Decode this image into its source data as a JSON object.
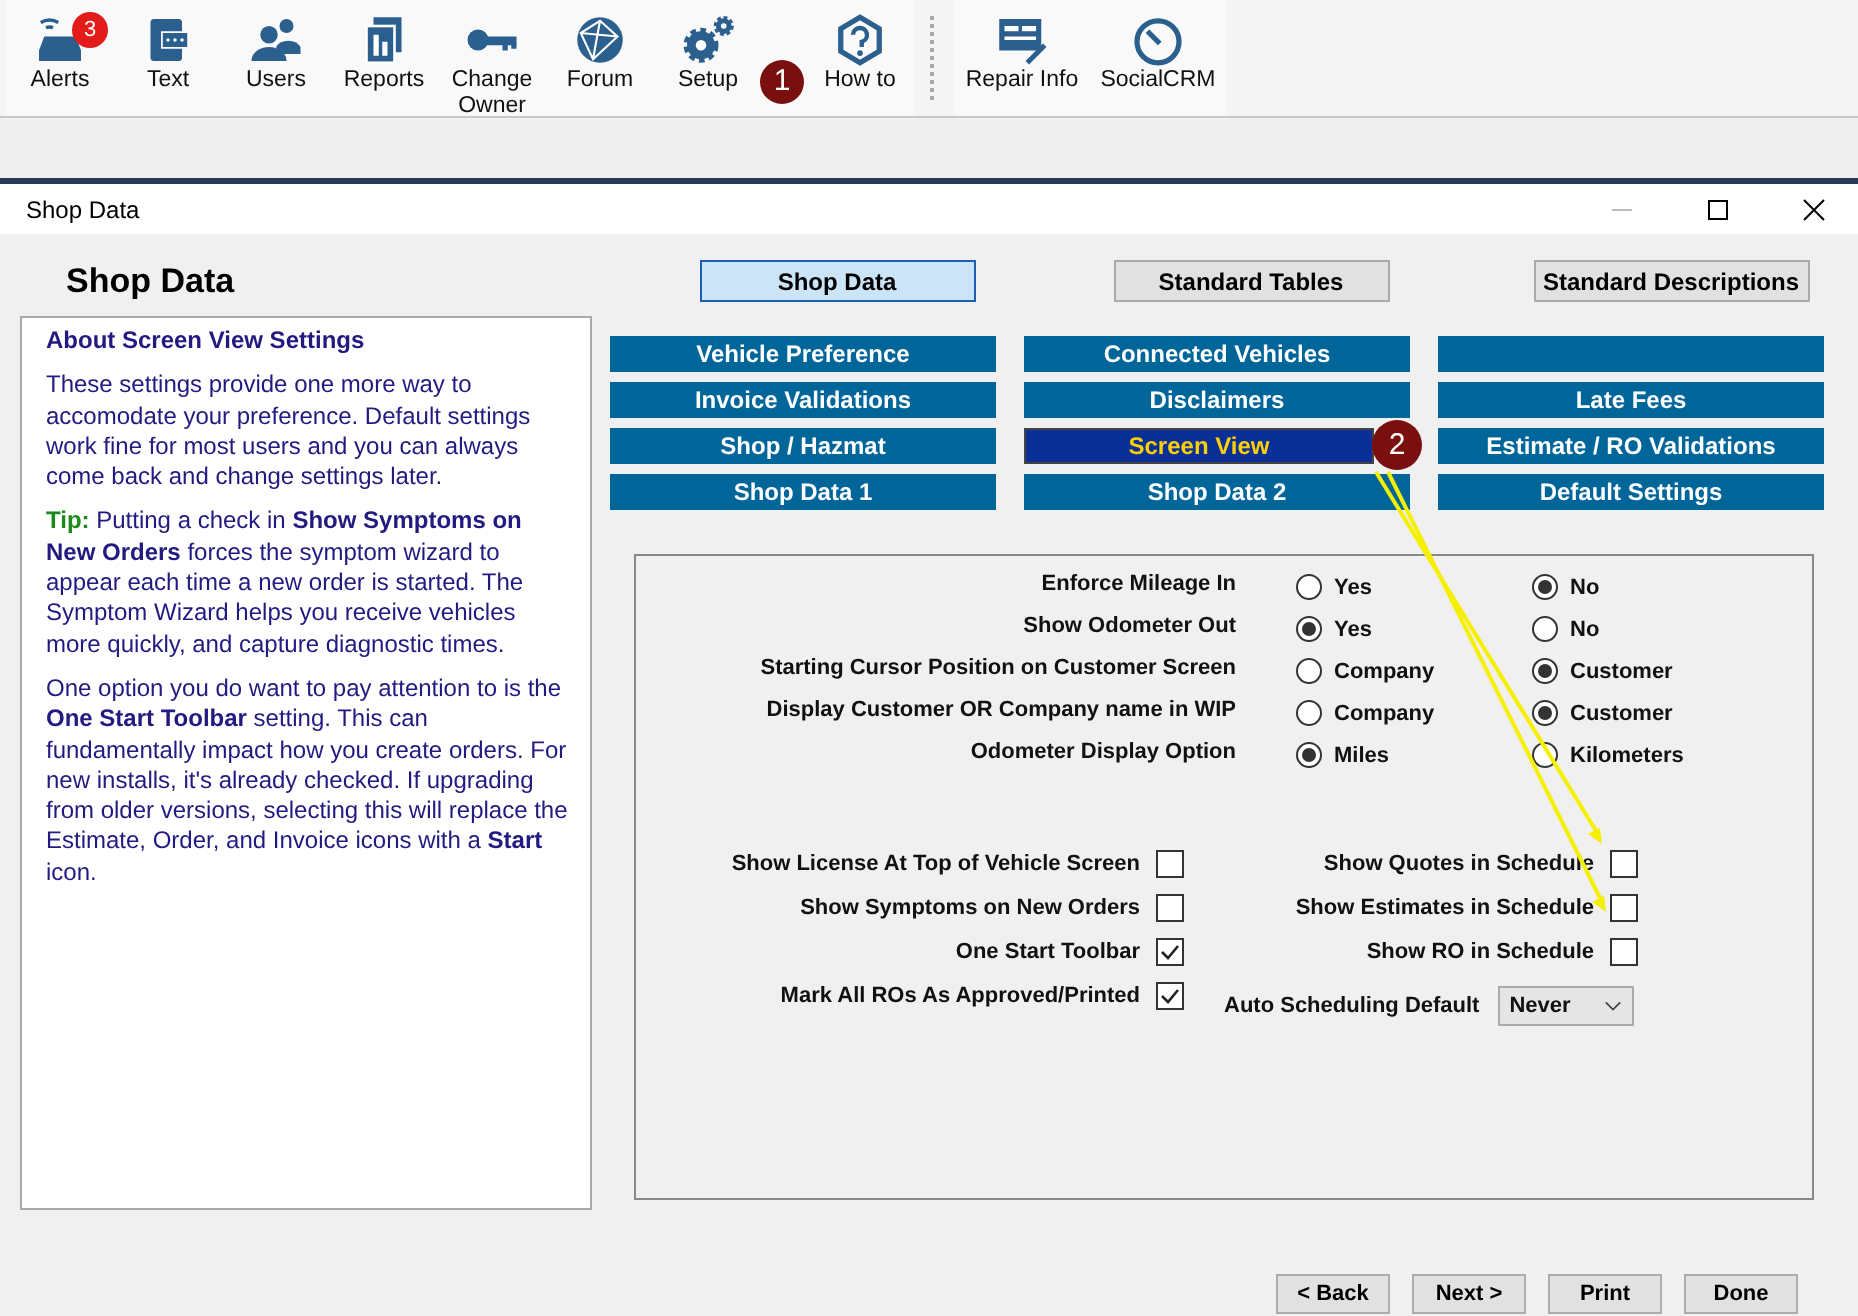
{
  "toolbar": {
    "groups": [
      [
        {
          "label": "Alerts",
          "badge": "3"
        },
        {
          "label": "Text"
        },
        {
          "label": "Users"
        },
        {
          "label": "Reports"
        },
        {
          "label": "Change Owner"
        },
        {
          "label": "Forum"
        },
        {
          "label": "Setup",
          "callout": "1"
        },
        {
          "label": "How to"
        }
      ],
      [
        {
          "label": "Repair Info"
        },
        {
          "label": "SocialCRM"
        }
      ]
    ]
  },
  "window": {
    "title": "Shop Data"
  },
  "heading": "Shop Data",
  "help": {
    "title": "About Screen View Settings",
    "intro": "These settings provide one more way to accomodate your preference. Default settings work fine for most users and you can always come back and change settings later.",
    "tip_label": "Tip:",
    "tip": "Putting a check in **Show Symptoms on New Orders** forces the symptom wizard to appear each time a new order is started. The Symptom Wizard helps you receive vehicles more quickly, and capture diagnostic times.",
    "note": "One option you do want to pay attention to is the **One Start Toolbar** setting. This can fundamentally impact how you create orders. For new installs, it's already checked. If upgrading from older versions, selecting this will replace the Estimate, Order, and Invoice icons with a **Start** icon."
  },
  "tabs": [
    {
      "label": "Shop Data",
      "selected": true
    },
    {
      "label": "Standard Tables",
      "selected": false
    },
    {
      "label": "Standard Descriptions",
      "selected": false
    }
  ],
  "sections": [
    {
      "label": "Vehicle Preference",
      "selected": false
    },
    {
      "label": "Connected Vehicles",
      "selected": false
    },
    {
      "selected": false
    },
    {
      "label": "Invoice Validations",
      "selected": false
    },
    {
      "label": "Disclaimers",
      "selected": false
    },
    {
      "label": "Late Fees",
      "selected": false
    },
    {
      "label": "Shop / Hazmat",
      "selected": false
    },
    {
      "label": "Screen View",
      "selected": true,
      "callout": "2"
    },
    {
      "label": "Estimate / RO Validations",
      "selected": false
    },
    {
      "label": "Shop Data 1",
      "selected": false
    },
    {
      "label": "Shop Data 2",
      "selected": false
    },
    {
      "label": "Default Settings",
      "selected": false
    }
  ],
  "radio_settings": [
    {
      "label": "Enforce Mileage In",
      "options": [
        {
          "label": "Yes",
          "selected": false
        },
        {
          "label": "No",
          "selected": true
        }
      ]
    },
    {
      "label": "Show Odometer Out",
      "options": [
        {
          "label": "Yes",
          "selected": true
        },
        {
          "label": "No",
          "selected": false
        }
      ]
    },
    {
      "label": "Starting Cursor Position on Customer Screen",
      "options": [
        {
          "label": "Company",
          "selected": false
        },
        {
          "label": "Customer",
          "selected": true
        }
      ]
    },
    {
      "label": "Display Customer OR Company name in WIP",
      "options": [
        {
          "label": "Company",
          "selected": false
        },
        {
          "label": "Customer",
          "selected": true
        }
      ]
    },
    {
      "label": "Odometer Display Option",
      "options": [
        {
          "label": "Miles",
          "selected": true
        },
        {
          "label": "Kilometers",
          "selected": false
        }
      ]
    }
  ],
  "left_settings": [
    {
      "kind": "checkbox",
      "label": "Show License At Top of Vehicle Screen",
      "checked": false
    },
    {
      "kind": "checkbox",
      "label": "Show Symptoms on New Orders",
      "checked": false
    },
    {
      "kind": "checkbox",
      "label": "One Start Toolbar",
      "checked": true
    },
    {
      "kind": "checkbox",
      "label": "Mark All ROs As Approved/Printed",
      "checked": true
    }
  ],
  "right_settings": [
    {
      "kind": "checkbox",
      "label": "Show Quotes in Schedule",
      "checked": false,
      "arrow": true
    },
    {
      "kind": "checkbox",
      "label": "Show Estimates in Schedule",
      "checked": false,
      "arrow": true
    },
    {
      "kind": "checkbox",
      "label": "Show RO in Schedule",
      "checked": false,
      "arrow": false
    },
    {
      "kind": "dropdown",
      "label": "Auto Scheduling Default",
      "value": "Never"
    }
  ],
  "footer_buttons": [
    "< Back",
    "Next >",
    "Print",
    "Done"
  ]
}
